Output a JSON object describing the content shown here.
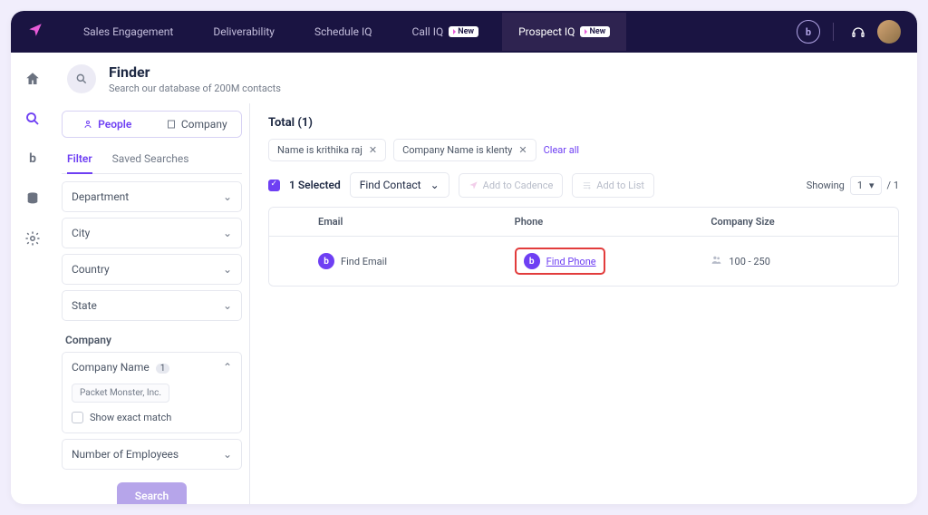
{
  "nav": {
    "items": [
      {
        "label": "Sales Engagement"
      },
      {
        "label": "Deliverability"
      },
      {
        "label": "Schedule IQ"
      },
      {
        "label": "Call IQ",
        "badge": "New"
      },
      {
        "label": "Prospect IQ",
        "badge": "New",
        "active": true
      }
    ],
    "badge_letter": "b"
  },
  "page": {
    "title": "Finder",
    "subtitle": "Search our database of 200M contacts"
  },
  "tabs": {
    "people": "People",
    "company": "Company"
  },
  "subtabs": {
    "filter": "Filter",
    "saved": "Saved Searches"
  },
  "filters": {
    "department": "Department",
    "city": "City",
    "country": "Country",
    "state": "State",
    "company_section": "Company",
    "company_name": "Company Name",
    "company_name_count": "1",
    "company_chip": "Packet Monster, Inc.",
    "exact_match": "Show exact match",
    "num_employees": "Number of Employees",
    "search": "Search"
  },
  "results": {
    "total": "Total (1)",
    "chips": [
      {
        "label": "Name is krithika raj"
      },
      {
        "label": "Company Name is klenty"
      }
    ],
    "clear_all": "Clear all",
    "selected": "1 Selected",
    "find_contact": "Find Contact",
    "add_cadence": "Add to Cadence",
    "add_list": "Add to List",
    "showing": "Showing",
    "page": "1",
    "page_total": "/ 1",
    "headers": {
      "email": "Email",
      "phone": "Phone",
      "size": "Company Size"
    },
    "row": {
      "find_email": "Find Email",
      "find_phone": "Find Phone",
      "size": "100 - 250"
    }
  }
}
